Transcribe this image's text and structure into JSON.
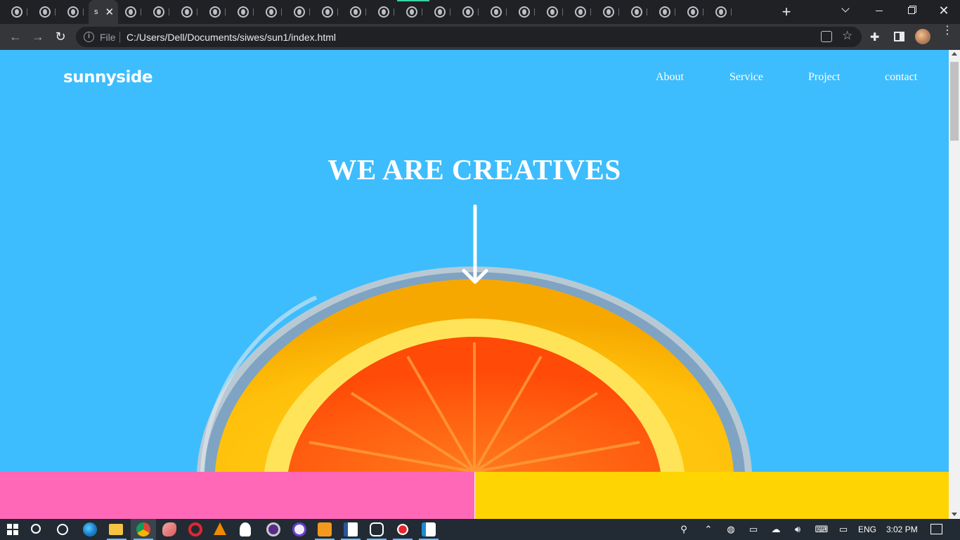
{
  "browser": {
    "active_tab_label": "s",
    "address_scheme": "File",
    "address_url": "C:/Users/Dell/Documents/siwes/sun1/index.html"
  },
  "site": {
    "logo": "sunnyside",
    "nav": [
      "About",
      "Service",
      "Project",
      "contact"
    ],
    "hero_title": "WE ARE CREATIVES"
  },
  "colors": {
    "page_background": "#3dbdfd",
    "pink_panel": "#fe68b6",
    "yellow_panel": "#fed502"
  },
  "taskbar": {
    "language": "ENG",
    "time": "3:02 PM",
    "apps": [
      "file-explorer-search",
      "cortana",
      "edge",
      "file-explorer",
      "chrome",
      "paint",
      "opera",
      "vlc",
      "teams",
      "obs",
      "brave",
      "sublime-text",
      "word",
      "photos",
      "recorder",
      "vscode"
    ]
  }
}
